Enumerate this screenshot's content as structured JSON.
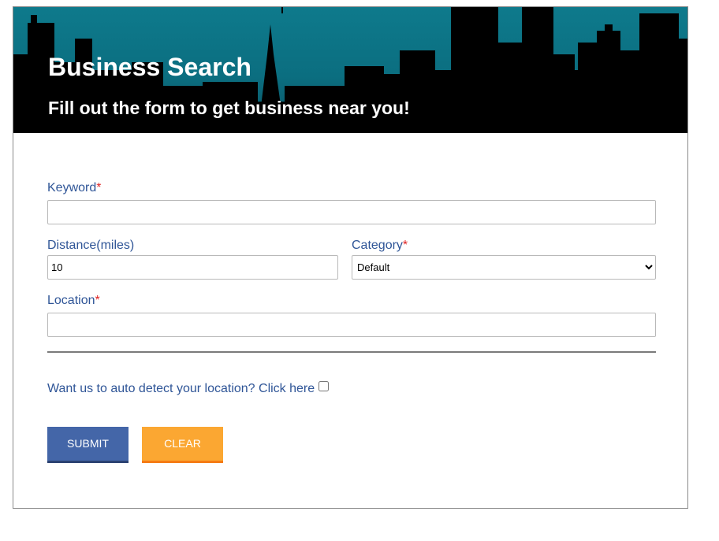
{
  "header": {
    "title": "Business Search",
    "subtitle": "Fill out the form to get business near you!"
  },
  "form": {
    "keyword": {
      "label": "Keyword",
      "required_mark": "*",
      "value": ""
    },
    "distance": {
      "label": "Distance(miles)",
      "value": "10"
    },
    "category": {
      "label": "Category",
      "required_mark": "*",
      "selected": "Default"
    },
    "location": {
      "label": "Location",
      "required_mark": "*",
      "value": ""
    },
    "autodetect": {
      "text": "Want us to auto detect your location? Click here",
      "checked": false
    }
  },
  "buttons": {
    "submit_label": "SUBMIT",
    "clear_label": "CLEAR"
  },
  "colors": {
    "label_blue": "#2f5597",
    "required_red": "#e02424",
    "submit_blue": "#4466a8",
    "clear_orange": "#fba732",
    "banner_teal": "#0b7f92"
  }
}
